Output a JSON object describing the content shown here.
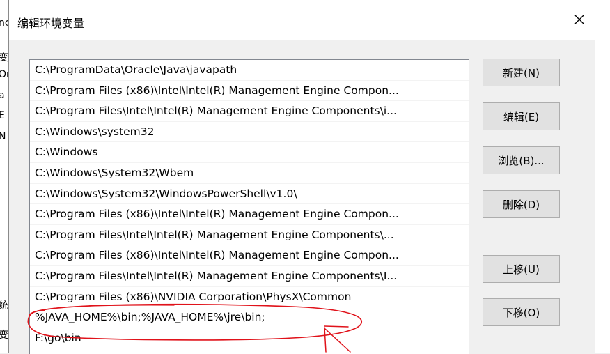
{
  "background_window": {
    "fragments": [
      "nc",
      "变",
      "Or",
      "a",
      "E",
      "N",
      "统",
      "变"
    ]
  },
  "dialog": {
    "title": "编辑环境变量",
    "close_glyph": "✕"
  },
  "path_entries": [
    "C:\\ProgramData\\Oracle\\Java\\javapath",
    "C:\\Program Files (x86)\\Intel\\Intel(R) Management Engine Compon...",
    "C:\\Program Files\\Intel\\Intel(R) Management Engine Components\\i...",
    "C:\\Windows\\system32",
    "C:\\Windows",
    "C:\\Windows\\System32\\Wbem",
    "C:\\Windows\\System32\\WindowsPowerShell\\v1.0\\",
    "C:\\Program Files (x86)\\Intel\\Intel(R) Management Engine Compon...",
    "C:\\Program Files\\Intel\\Intel(R) Management Engine Components\\...",
    "C:\\Program Files (x86)\\Intel\\Intel(R) Management Engine Compon...",
    "C:\\Program Files\\Intel\\Intel(R) Management Engine Components\\I...",
    "C:\\Program Files (x86)\\NVIDIA Corporation\\PhysX\\Common",
    "%JAVA_HOME%\\bin;%JAVA_HOME%\\jre\\bin;",
    "F:\\go\\bin"
  ],
  "buttons": {
    "new": "新建(N)",
    "edit": "编辑(E)",
    "browse": "浏览(B)...",
    "delete": "删除(D)",
    "move_up": "上移(U)",
    "move_down": "下移(O)"
  },
  "colors": {
    "annotation": "#e0121a",
    "button_face": "#e1e1e1",
    "button_border": "#adadad",
    "list_border": "#828790"
  }
}
